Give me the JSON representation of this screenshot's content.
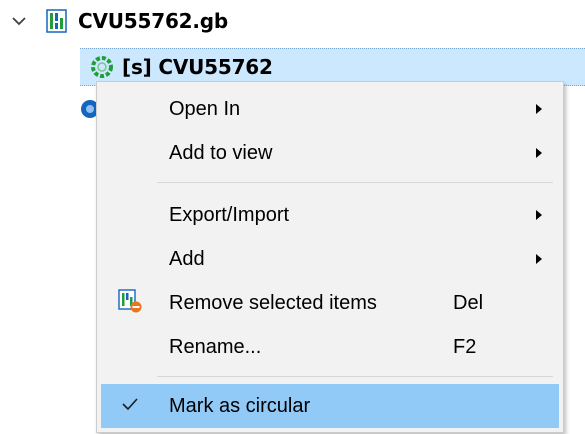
{
  "tree": {
    "document": {
      "label": "CVU55762.gb",
      "expanded": true,
      "icon": "genbank-document-icon"
    },
    "sequence": {
      "label": "[s] CVU55762",
      "icon": "circular-sequence-icon",
      "selected": true
    },
    "other": {
      "icon": "annotation-object-icon"
    }
  },
  "menu": {
    "items": [
      {
        "label": "Open In",
        "shortcut": "",
        "submenu": true
      },
      {
        "label": "Add to view",
        "shortcut": "",
        "submenu": true
      },
      {
        "label": "Export/Import",
        "shortcut": "",
        "submenu": true
      },
      {
        "label": "Add",
        "shortcut": "",
        "submenu": true
      },
      {
        "label": "Remove selected items",
        "shortcut": "Del",
        "submenu": false,
        "icon": "remove-items-icon"
      },
      {
        "label": "Rename...",
        "shortcut": "F2",
        "submenu": false
      },
      {
        "label": "Mark as circular",
        "shortcut": "",
        "submenu": false,
        "checked": true,
        "icon": "checkmark-icon"
      }
    ]
  },
  "colors": {
    "selection": "#cce8ff",
    "menu_background": "#f2f2f2",
    "checked_highlight": "#91c9f7",
    "accent_green": "#1f9e3a",
    "accent_blue": "#1565c0",
    "accent_orange": "#e8741c"
  }
}
